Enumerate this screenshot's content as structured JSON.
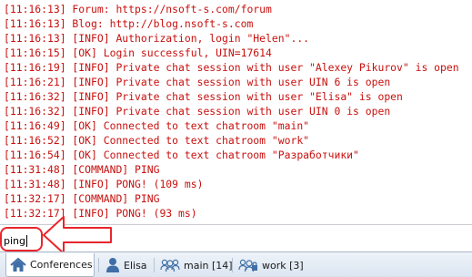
{
  "log": [
    "[11:16:13] Forum: https://nsoft-s.com/forum",
    "[11:16:13] Blog: http://blog.nsoft-s.com",
    "[11:16:13] [INFO] Authorization, login \"Helen\"...",
    "[11:16:15] [OK] Login successful, UIN=17614",
    "[11:16:19] [INFO] Private chat session with user \"Alexey Pikurov\" is open",
    "[11:16:21] [INFO] Private chat session with user UIN 6 is open",
    "[11:16:32] [INFO] Private chat session with user \"Elisa\" is open",
    "[11:16:32] [INFO] Private chat session with user UIN 0 is open",
    "[11:16:49] [OK] Connected to text chatroom \"main\"",
    "[11:16:52] [OK] Connected to text chatroom \"work\"",
    "[11:16:54] [OK] Connected to text chatroom \"Разработчики\"",
    "[11:31:48] [COMMAND] PING",
    "[11:31:48] [INFO] PONG! (109 ms)",
    "[11:32:17] [COMMAND] PING",
    "[11:32:17] [INFO] PONG! (93 ms)"
  ],
  "input": {
    "value": "ping",
    "placeholder": ""
  },
  "tabs": [
    {
      "id": "conferences",
      "label": "Conferences",
      "icon": "home-icon",
      "active": true
    },
    {
      "id": "elisa",
      "label": "Elisa",
      "icon": "user-icon",
      "active": false
    },
    {
      "id": "main",
      "label": "main [14]",
      "icon": "group-icon",
      "active": false
    },
    {
      "id": "work",
      "label": "work [3]",
      "icon": "group-lock-icon",
      "active": false
    }
  ],
  "colors": {
    "log_text": "#c8100e",
    "annotation": "#e8262c",
    "tab_icon": "#3f6fa6"
  }
}
